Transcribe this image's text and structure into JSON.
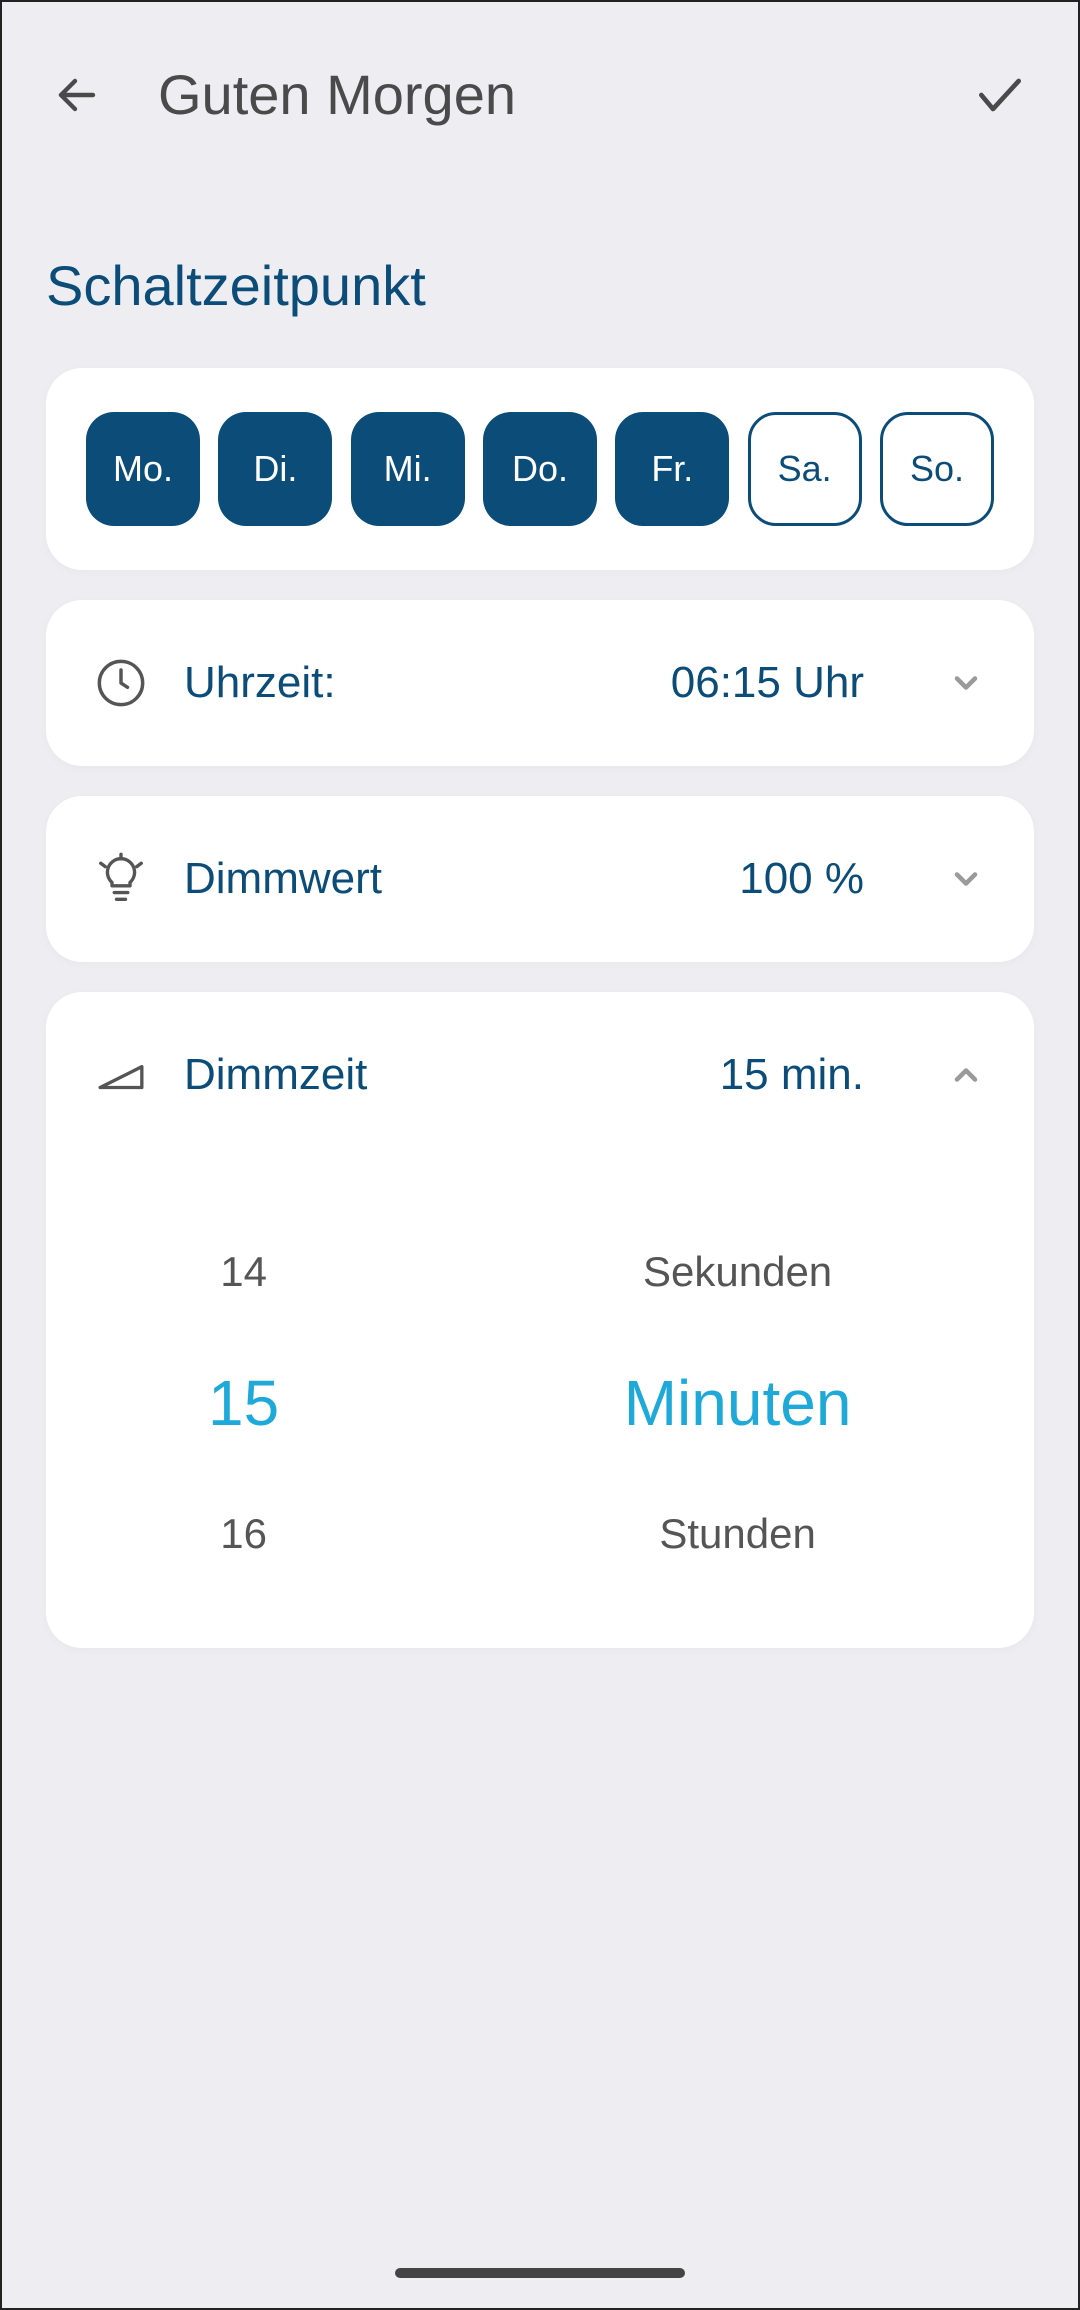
{
  "header": {
    "title": "Guten Morgen"
  },
  "section_title": "Schaltzeitpunkt",
  "weekdays": [
    {
      "label": "Mo.",
      "selected": true
    },
    {
      "label": "Di.",
      "selected": true
    },
    {
      "label": "Mi.",
      "selected": true
    },
    {
      "label": "Do.",
      "selected": true
    },
    {
      "label": "Fr.",
      "selected": true
    },
    {
      "label": "Sa.",
      "selected": false
    },
    {
      "label": "So.",
      "selected": false
    }
  ],
  "rows": {
    "time": {
      "label": "Uhrzeit:",
      "value": "06:15 Uhr"
    },
    "dim_value": {
      "label": "Dimmwert",
      "value": "100 %"
    },
    "dim_time": {
      "label": "Dimmzeit",
      "value": "15 min."
    }
  },
  "picker": {
    "num_prev": "14",
    "num_sel": "15",
    "num_next": "16",
    "unit_prev": "Sekunden",
    "unit_sel": "Minuten",
    "unit_next": "Stunden"
  }
}
